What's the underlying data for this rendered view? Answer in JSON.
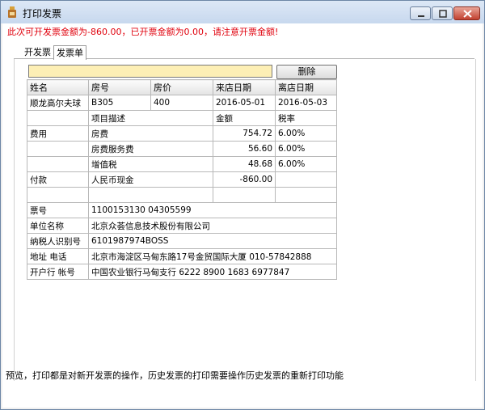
{
  "window": {
    "title": "打印发票",
    "icon": "printer-icon"
  },
  "warning": "此次可开发票金额为-860.00，已开票金额为0.00，请注意开票金额!",
  "tabs": [
    {
      "label": "开发票"
    },
    {
      "label": "发票单",
      "active": true
    }
  ],
  "toolbar": {
    "input_value": "",
    "delete_label": "删除"
  },
  "table": {
    "headers": [
      "姓名",
      "房号",
      "房价",
      "来店日期",
      "离店日期"
    ],
    "guest": {
      "name": "顺龙高尔夫球",
      "room": "B305",
      "price": "400",
      "checkin": "2016-05-01",
      "checkout": "2016-05-03"
    },
    "item_headers": {
      "desc": "项目描述",
      "amount": "金额",
      "rate": "税率"
    },
    "fee_label": "费用",
    "fees": [
      {
        "desc": "房费",
        "amount": "754.72",
        "rate": "6.00%"
      },
      {
        "desc": "房费服务费",
        "amount": "56.60",
        "rate": "6.00%"
      },
      {
        "desc": "增值税",
        "amount": "48.68",
        "rate": "6.00%"
      }
    ],
    "payment": {
      "label": "付款",
      "desc": "人民币现金",
      "amount": "-860.00"
    },
    "invoice_no": {
      "label": "票号",
      "value": "1100153130 04305599"
    },
    "company": {
      "label": "单位名称",
      "value": "北京众荟信息技术股份有限公司"
    },
    "tax_id": {
      "label": "纳税人识别号",
      "value": "6101987974BOSS"
    },
    "address": {
      "label": "地址  电话",
      "value": "北京市海淀区马甸东路17号金贸国际大厦    010-57842888"
    },
    "bank": {
      "label": "开户行  帐号",
      "value": "中国农业银行马甸支行    6222 8900 1683 6977847"
    }
  },
  "status_text": "预览，打印都是对新开发票的操作，历史发票的打印需要操作历史发票的重新打印功能",
  "colors": {
    "warning": "#e0000c",
    "input_bg": "#fdefb5"
  }
}
